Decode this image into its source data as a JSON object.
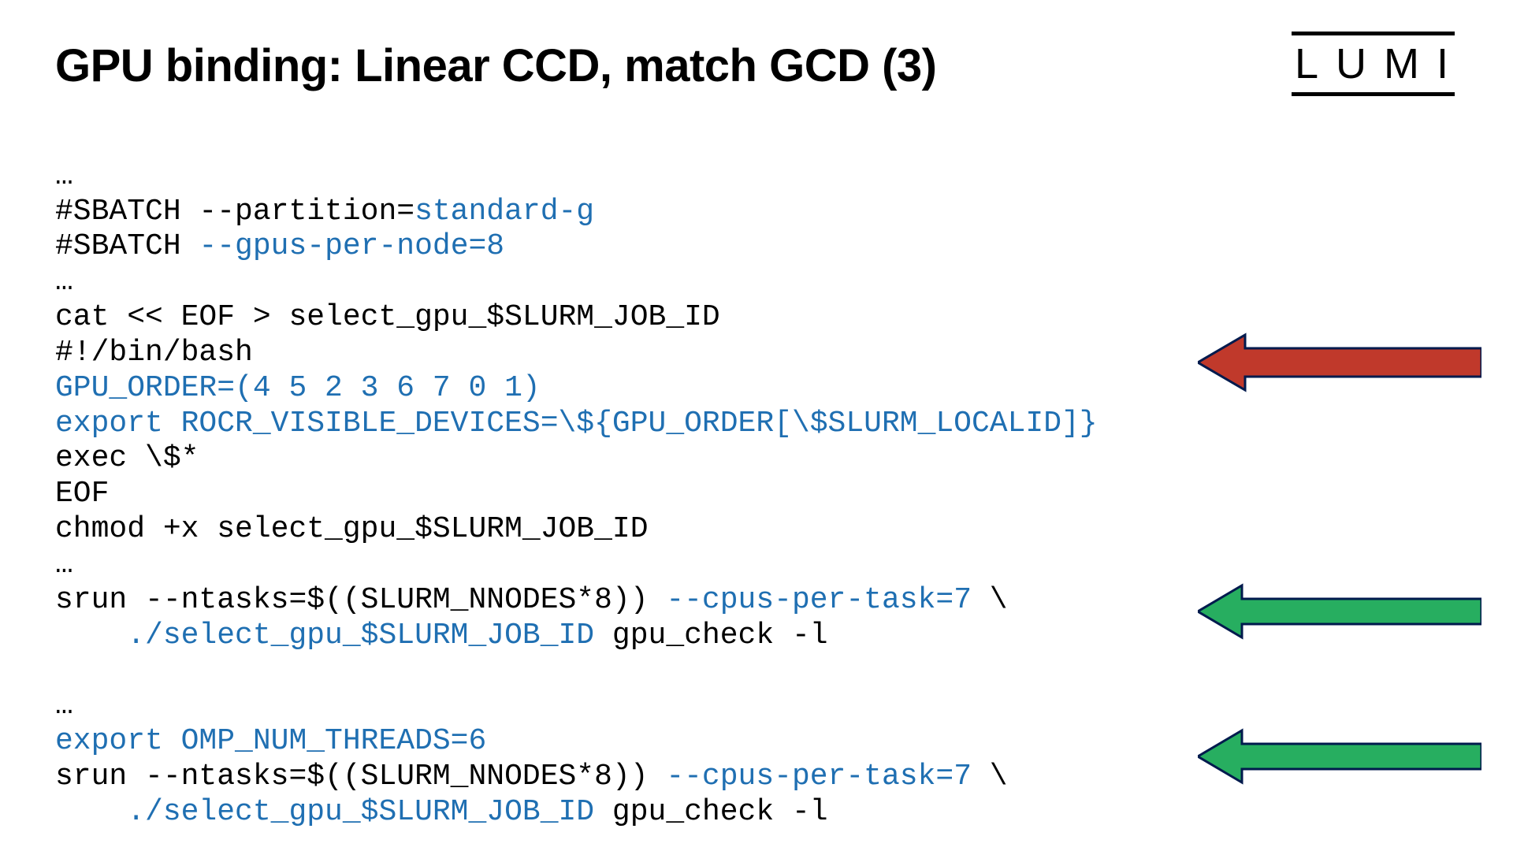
{
  "logo": "LUMI",
  "title": "GPU binding: Linear CCD, match GCD (3)",
  "code": {
    "l01": "…",
    "l02a": "#SBATCH --partition=",
    "l02b": "standard-g",
    "l03a": "#SBATCH ",
    "l03b": "--gpus-per-node=8",
    "l04": "…",
    "l05": "cat << EOF > select_gpu_$SLURM_JOB_ID",
    "l06": "#!/bin/bash",
    "l07": "GPU_ORDER=(4 5 2 3 6 7 0 1)",
    "l08": "export ROCR_VISIBLE_DEVICES=\\${GPU_ORDER[\\$SLURM_LOCALID]}",
    "l09": "exec \\$*",
    "l10": "EOF",
    "l11": "chmod +x select_gpu_$SLURM_JOB_ID",
    "l12": "…",
    "l13a": "srun --ntasks=$((SLURM_NNODES*8)) ",
    "l13b": "--cpus-per-task=7",
    "l13c": " \\",
    "l14a": "    ",
    "l14b": "./select_gpu_$SLURM_JOB_ID",
    "l14c": " gpu_check -l",
    "l15blank": "",
    "l16": "…",
    "l17": "export OMP_NUM_THREADS=6",
    "l18a": "srun --ntasks=$((SLURM_NNODES*8)) ",
    "l18b": "--cpus-per-task=7",
    "l18c": " \\",
    "l19a": "    ",
    "l19b": "./select_gpu_$SLURM_JOB_ID",
    "l19c": " gpu_check -l"
  },
  "arrows": {
    "red": {
      "color_fill": "#c0392b",
      "color_stroke": "#001a4d"
    },
    "green1": {
      "color_fill": "#27ae60",
      "color_stroke": "#001a4d"
    },
    "green2": {
      "color_fill": "#27ae60",
      "color_stroke": "#001a4d"
    }
  }
}
